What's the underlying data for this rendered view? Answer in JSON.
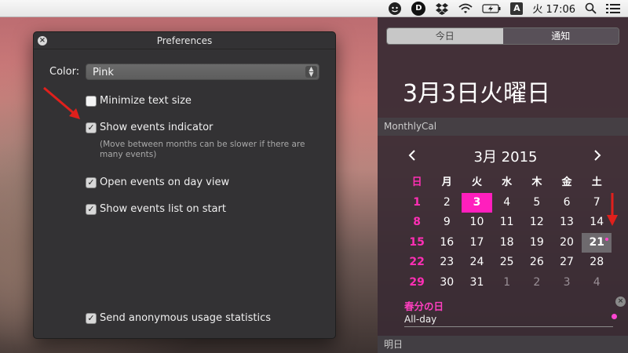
{
  "menubar": {
    "icons": [
      "face-icon",
      "d-icon",
      "dropbox-icon",
      "wifi-icon",
      "battery-icon",
      "input-a-icon",
      "search-icon",
      "list-icon"
    ],
    "input_badge": "A",
    "d_badge": "D",
    "clock": "火 17:06"
  },
  "prefs": {
    "title": "Preferences",
    "color_label": "Color:",
    "color_value": "Pink",
    "options": [
      {
        "label": "Minimize text size",
        "checked": false
      },
      {
        "label": "Show events indicator",
        "checked": true
      },
      {
        "label": "Open events on day view",
        "checked": true
      },
      {
        "label": "Show events list on start",
        "checked": true
      },
      {
        "label": "Send anonymous usage statistics",
        "checked": true
      }
    ],
    "hint": "(Move between months can be slower if there are many events)"
  },
  "nc": {
    "tab_today": "今日",
    "tab_notifications": "通知",
    "date_heading": "3月3日火曜日",
    "widget_name": "MonthlyCal",
    "month_title": "3月 2015",
    "weekdays": [
      "日",
      "月",
      "火",
      "水",
      "木",
      "金",
      "土"
    ],
    "weeks": [
      [
        "1",
        "2",
        "3",
        "4",
        "5",
        "6",
        "7"
      ],
      [
        "8",
        "9",
        "10",
        "11",
        "12",
        "13",
        "14"
      ],
      [
        "15",
        "16",
        "17",
        "18",
        "19",
        "20",
        "21"
      ],
      [
        "22",
        "23",
        "24",
        "25",
        "26",
        "27",
        "28"
      ],
      [
        "29",
        "30",
        "31",
        "1",
        "2",
        "3",
        "4"
      ]
    ],
    "today_day": "3",
    "selected_day": "21",
    "event_title": "春分の日",
    "event_time": "All-day",
    "tomorrow_label": "明日"
  },
  "colors": {
    "accent": "#ff1fbd",
    "prefs_bg": "#333234",
    "nc_bg": "#3a2c34"
  }
}
